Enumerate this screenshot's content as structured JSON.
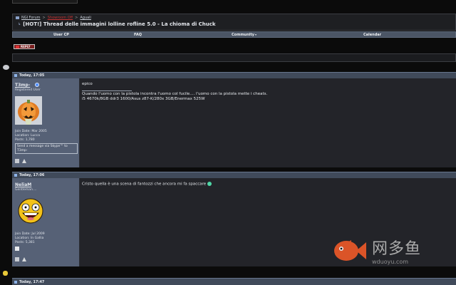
{
  "breadcrumb": {
    "items": [
      "NGI Forum",
      "Showroom Off",
      "Aguali"
    ],
    "title": "[HOT!] Thread delle immagini lolline rofline 5.0 - La chioma di Chuck"
  },
  "menubar": {
    "items": [
      "User CP",
      "FAQ",
      "Community",
      "Calendar"
    ]
  },
  "reply_label": "REPLY",
  "posts": [
    {
      "date": "Today, 17:05",
      "username": "T3mp-",
      "user_title": "Registered User",
      "join_date": "Join Date: Mar 2005",
      "location": "Location: Lucca",
      "posts": "Posts: 1,780",
      "skype": "Send a message via Skype™ to T3mp-",
      "message": "epico",
      "signature_1": "Quando l'uomo con la pistola incontra l'uomo col fucile.... l'uomo con la pistola mette i cheats.",
      "signature_2": "i5 4670k/8GB ddr3 1600/Asus z87-K/280x 3GB/Enermax 525W"
    },
    {
      "date": "Today, 17:06",
      "username": "NeliaM",
      "user_title": "Gentleman....",
      "join_date": "Join Date: Jul 2009",
      "location": "Location: In Gallia",
      "posts": "Posts: 5,381",
      "message": "Cristo quella è una scena di fantozzi che ancora mi fa spaccare"
    },
    {
      "date": "Today, 17:47"
    }
  ],
  "watermark": {
    "cn": "网多鱼",
    "url": "wduoyu.com"
  },
  "colors": {
    "accent_red": "#c53333",
    "header_blue": "#404a5a",
    "userpane": "#566176",
    "watermark_orange": "#f05a28"
  }
}
